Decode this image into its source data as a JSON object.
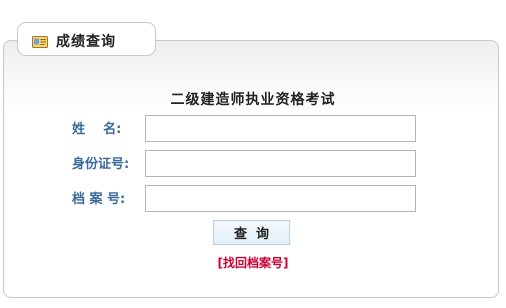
{
  "header": {
    "icon": "id-card-icon",
    "title": "成绩查询"
  },
  "form": {
    "title": "二级建造师执业资格考试",
    "fields": [
      {
        "label": "姓    名:",
        "value": "",
        "placeholder": ""
      },
      {
        "label": "身份证号:",
        "value": "",
        "placeholder": ""
      },
      {
        "label": "档 案 号:",
        "value": "",
        "placeholder": ""
      }
    ],
    "submit_label": "查  询",
    "recover_link": "[找回档案号]"
  },
  "colors": {
    "label": "#3a6a9a",
    "link": "#cc0033",
    "border": "#c9c9c9",
    "button_bg": "#e2eef8"
  }
}
